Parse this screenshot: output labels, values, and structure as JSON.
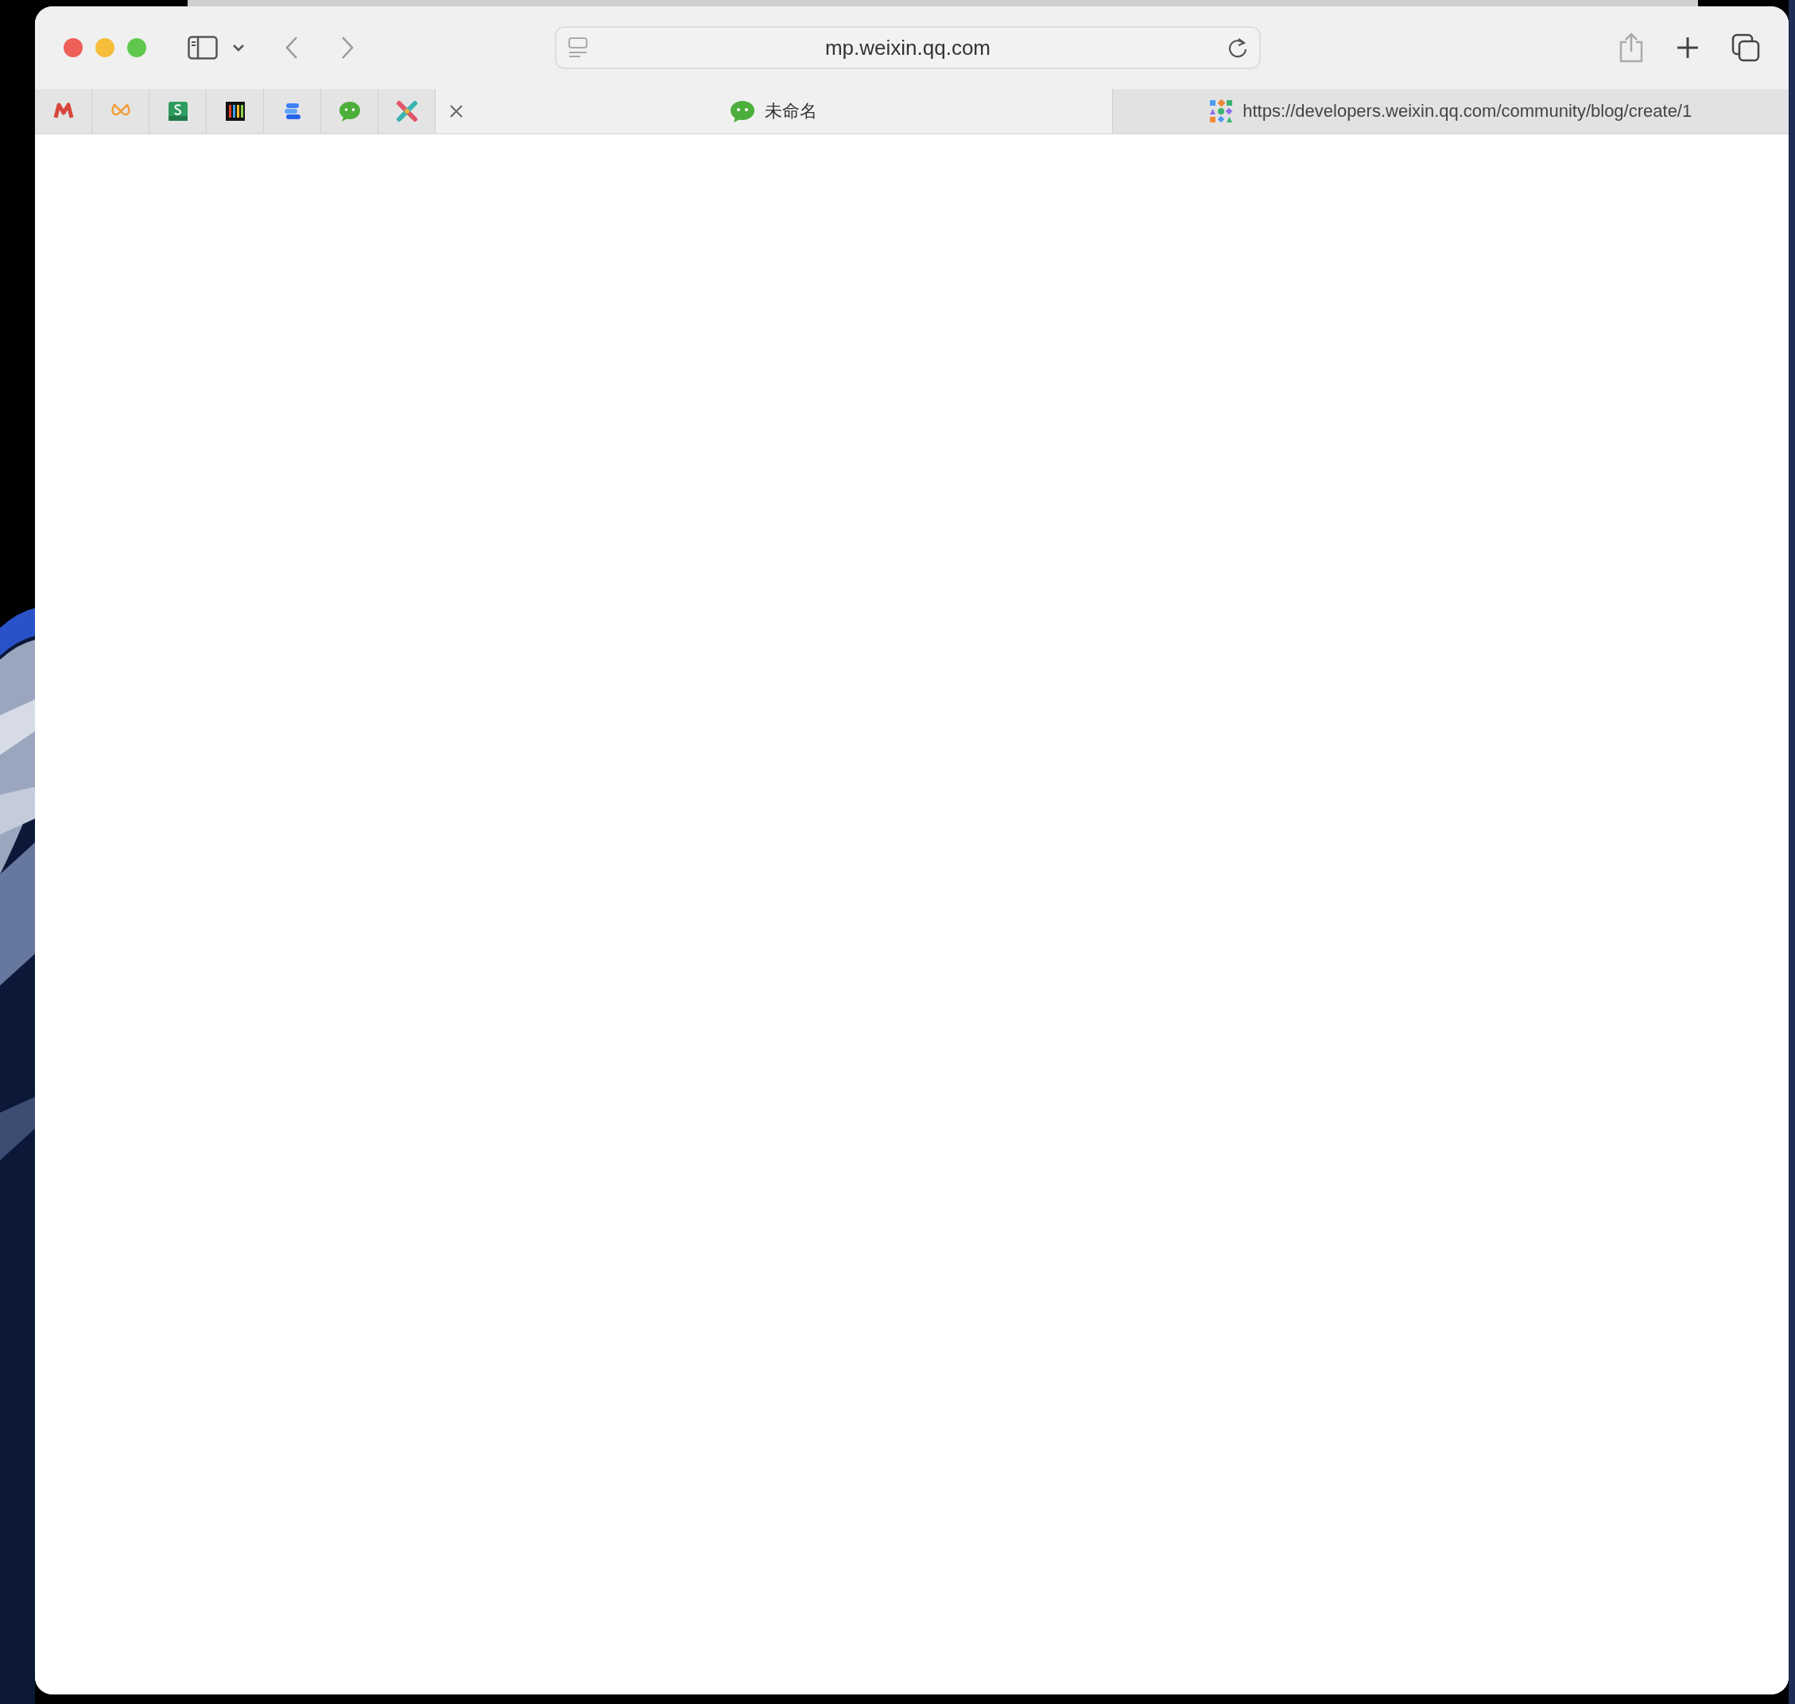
{
  "toolbar": {
    "address": "mp.weixin.qq.com"
  },
  "tabs": [
    {
      "title": "未命名",
      "selected": true
    },
    {
      "title": "https://developers.weixin.qq.com/community/blog/create/1",
      "selected": false
    }
  ]
}
